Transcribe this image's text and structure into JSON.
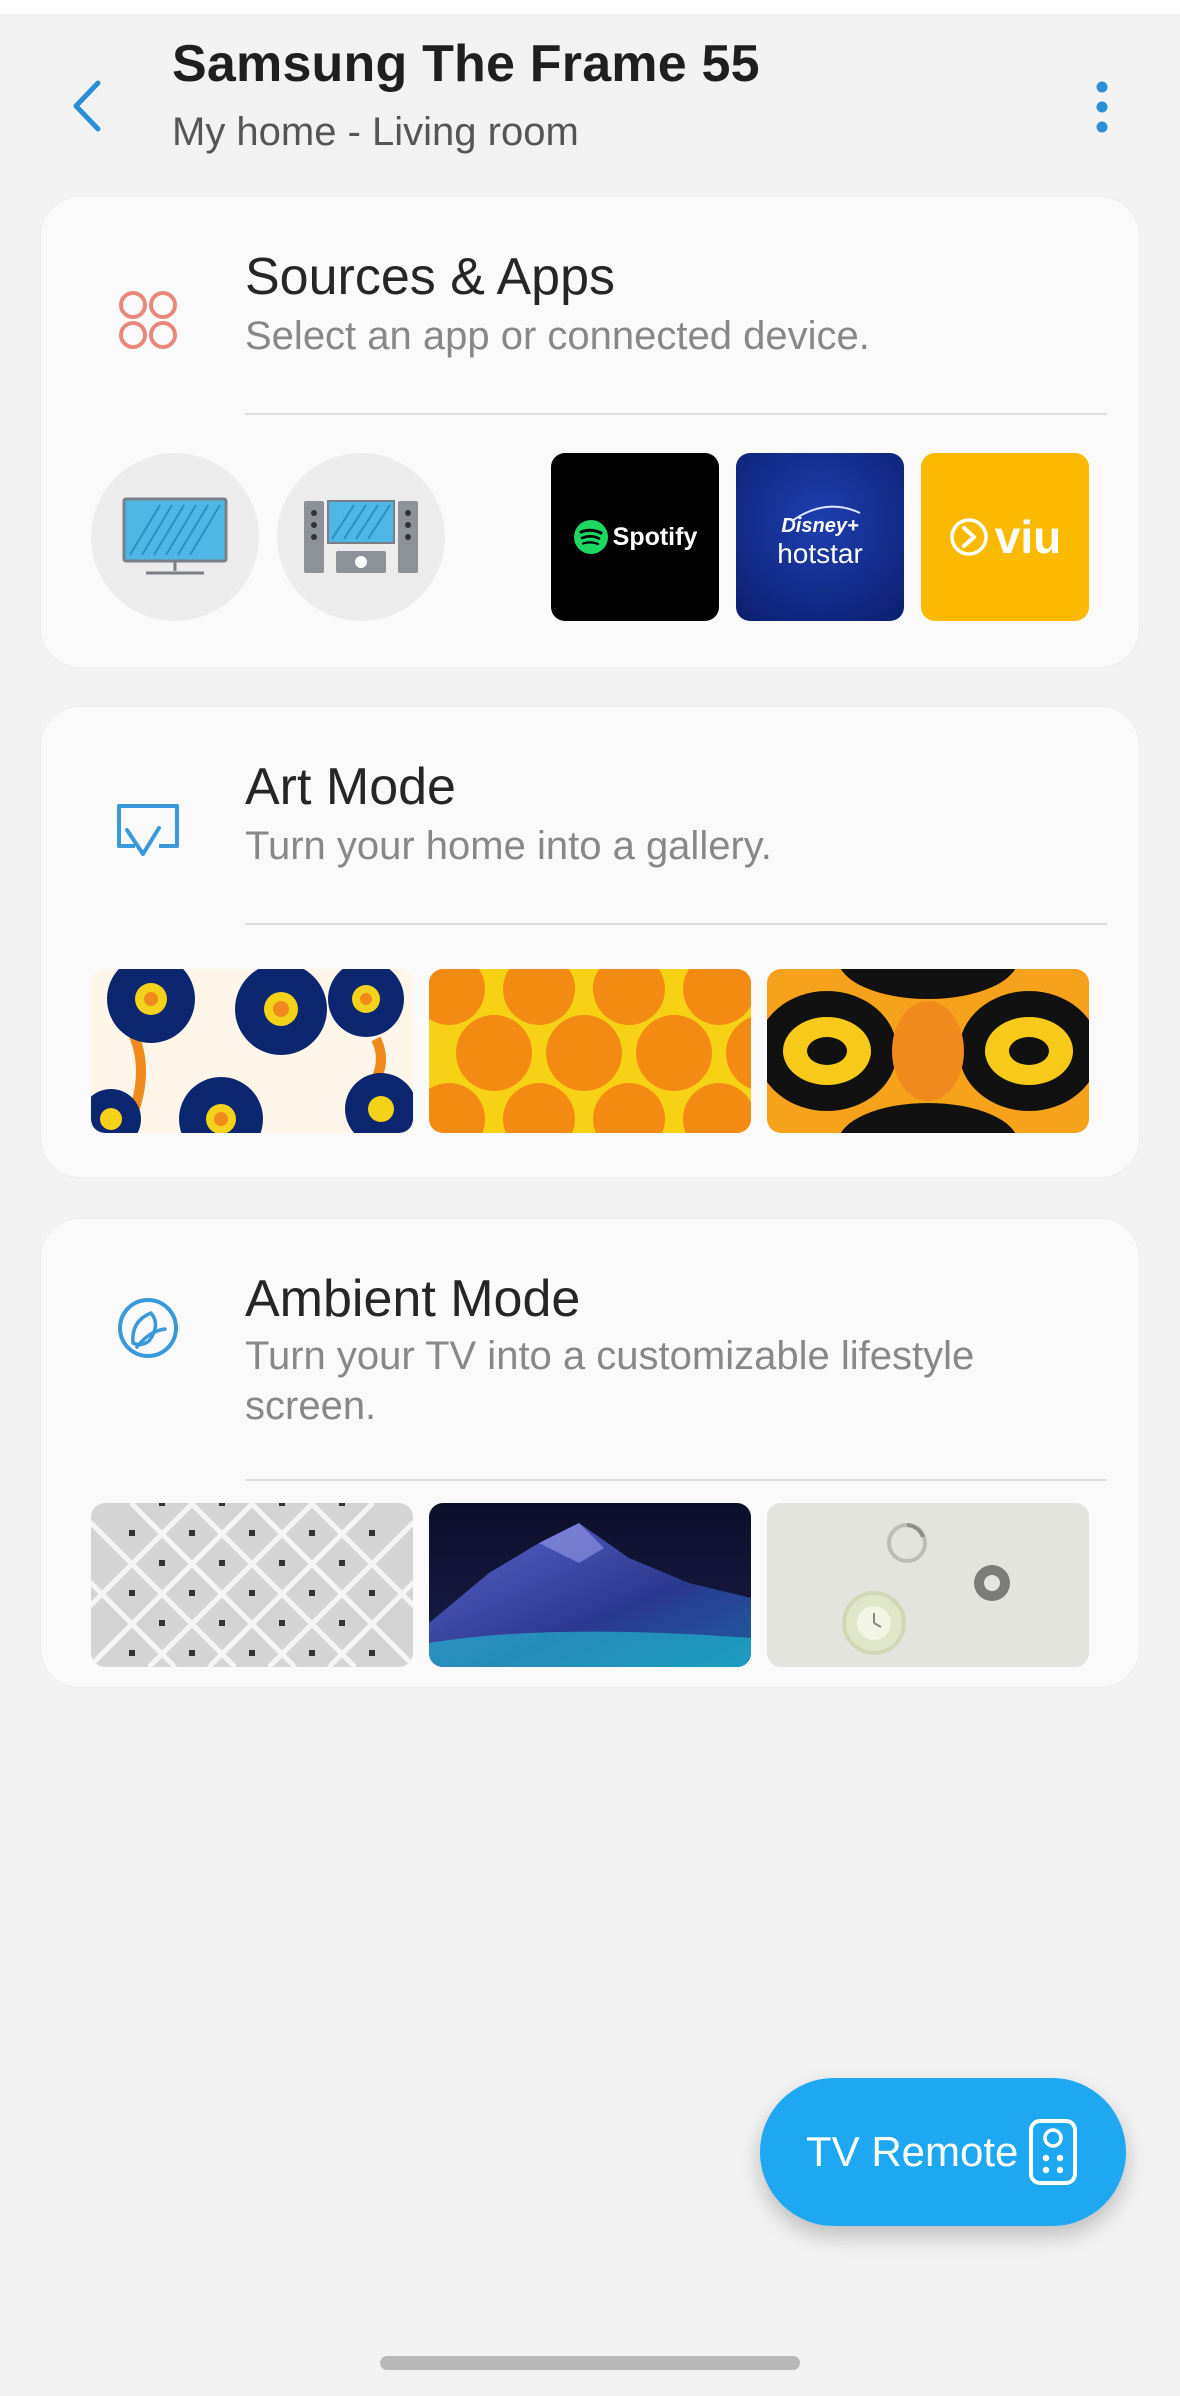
{
  "header": {
    "title": "Samsung The Frame 55",
    "subtitle": "My home - Living room"
  },
  "sources": {
    "title": "Sources & Apps",
    "desc": "Select an app or connected device.",
    "devices": [
      {
        "icon": "tv-device-icon"
      },
      {
        "icon": "home-theater-icon"
      }
    ],
    "apps": [
      {
        "name": "Spotify",
        "bg": "#000000"
      },
      {
        "name_line1": "Disney+",
        "name_line2": "hotstar",
        "bg": "#0f2a8a"
      },
      {
        "name": "viu",
        "bg": "#fbba00"
      }
    ]
  },
  "art": {
    "title": "Art Mode",
    "desc": "Turn your home into a gallery."
  },
  "ambient": {
    "title": "Ambient Mode",
    "desc": "Turn your TV into a customizable lifestyle screen."
  },
  "fab": {
    "label": "TV Remote"
  },
  "colors": {
    "accent": "#1ea8f2",
    "back_arrow": "#2b8fd6",
    "sources_icon": "#e8887a",
    "art_icon": "#3a9ad9"
  }
}
